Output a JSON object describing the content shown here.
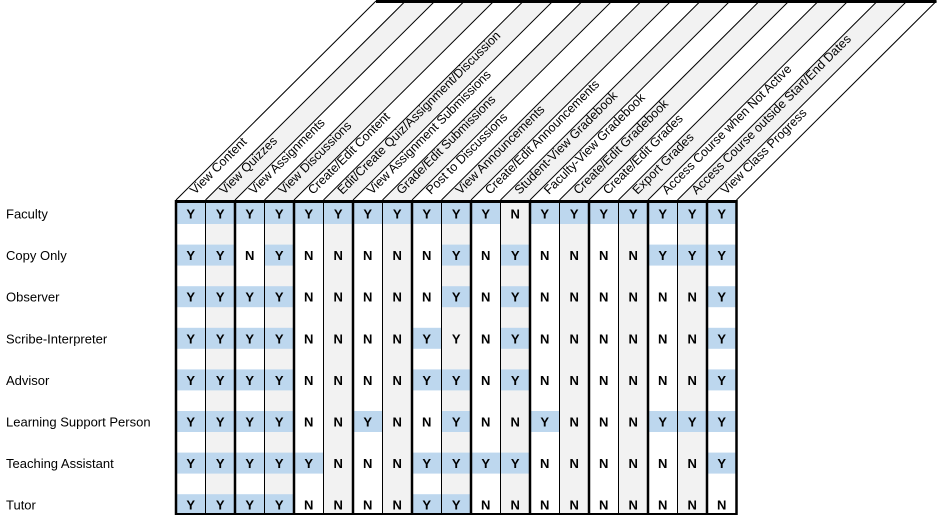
{
  "columns": [
    "View Content",
    "View Quizzes",
    "View Assignments",
    "View Discussions",
    "Create/Edit Content",
    "Edit/Create Quiz/Assignment/Discussion",
    "View Assignment Submissions",
    "Grade/Edit Submissions",
    "Post to Discussions",
    "View Announcements",
    "Create/Edit Announcements",
    "Student-View Gradebook",
    "Faculty-View Gradebook",
    "Create/Edit Gradebook",
    "Create/Edit Grades",
    "Export Grades",
    "Access Course when Not Active",
    "Access Course outside Start/End Dates",
    "View Class Progress"
  ],
  "rows": [
    {
      "label": "Faculty",
      "values": [
        "Y",
        "Y",
        "Y",
        "Y",
        "Y",
        "Y",
        "Y",
        "Y",
        "Y",
        "Y",
        "Y",
        "N",
        "Y",
        "Y",
        "Y",
        "Y",
        "Y",
        "Y",
        "Y"
      ]
    },
    {
      "label": "Copy Only",
      "values": [
        "Y",
        "Y",
        "N",
        "Y",
        "N",
        "N",
        "N",
        "N",
        "N",
        "Y",
        "N",
        "Y",
        "N",
        "N",
        "N",
        "N",
        "Y",
        "Y",
        "Y"
      ]
    },
    {
      "label": "Observer",
      "values": [
        "Y",
        "Y",
        "Y",
        "Y",
        "N",
        "N",
        "N",
        "N",
        "N",
        "Y",
        "N",
        "Y",
        "N",
        "N",
        "N",
        "N",
        "N",
        "N",
        "Y"
      ]
    },
    {
      "label": "Scribe-Interpreter",
      "values": [
        "Y",
        "Y",
        "Y",
        "Y",
        "N",
        "N",
        "N",
        "N",
        "Y",
        "Y",
        "N",
        "Y",
        "N",
        "N",
        "N",
        "N",
        "N",
        "N",
        "Y"
      ],
      "unhighlighted": [
        9
      ]
    },
    {
      "label": "Advisor",
      "values": [
        "Y",
        "Y",
        "Y",
        "Y",
        "N",
        "N",
        "N",
        "N",
        "Y",
        "Y",
        "N",
        "Y",
        "N",
        "N",
        "N",
        "N",
        "N",
        "N",
        "Y"
      ]
    },
    {
      "label": "Learning Support Person",
      "values": [
        "Y",
        "Y",
        "Y",
        "Y",
        "N",
        "N",
        "Y",
        "N",
        "N",
        "Y",
        "N",
        "N",
        "Y",
        "N",
        "N",
        "N",
        "Y",
        "Y",
        "Y"
      ]
    },
    {
      "label": "Teaching Assistant",
      "values": [
        "Y",
        "Y",
        "Y",
        "Y",
        "Y",
        "N",
        "N",
        "N",
        "Y",
        "Y",
        "Y",
        "Y",
        "N",
        "N",
        "N",
        "N",
        "N",
        "N",
        "Y"
      ]
    },
    {
      "label": "Tutor",
      "values": [
        "Y",
        "Y",
        "Y",
        "Y",
        "N",
        "N",
        "N",
        "N",
        "Y",
        "Y",
        "N",
        "N",
        "N",
        "N",
        "N",
        "N",
        "N",
        "N",
        "N"
      ]
    }
  ],
  "colors": {
    "yes_highlight": "#bdd7ee",
    "alt_column": "#f2f2f2",
    "border": "#000000"
  }
}
